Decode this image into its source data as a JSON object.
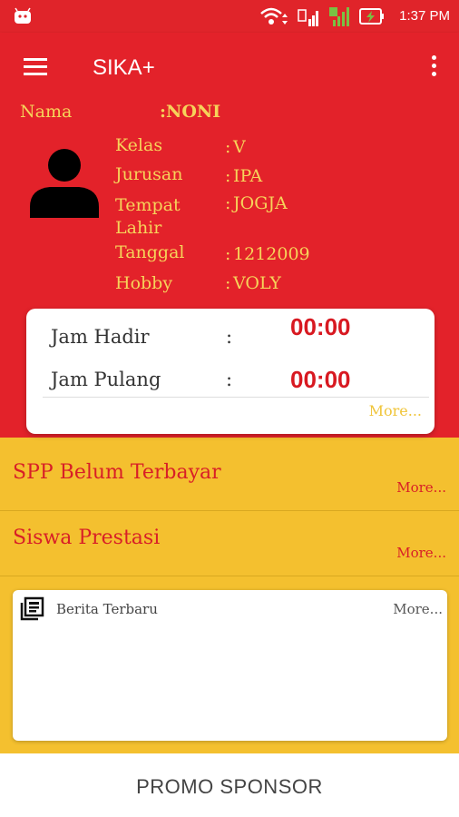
{
  "status_bar": {
    "time": "1:37 PM"
  },
  "app_bar": {
    "title": "SIKA+"
  },
  "profile": {
    "nama_label": "Nama",
    "nama_value": ":NONI",
    "kelas_label": "Kelas",
    "kelas_value": "V",
    "jurusan_label": "Jurusan",
    "jurusan_value": "IPA",
    "tempat_label_line1": "Tempat",
    "tempat_label_line2": "Lahir",
    "tempat_value": "JOGJA",
    "tanggal_label": "Tanggal",
    "tanggal_value": "1212009",
    "hobby_label": "Hobby",
    "hobby_value": "VOLY",
    "colon": ":"
  },
  "attendance": {
    "jam_hadir_label": "Jam Hadir",
    "jam_hadir_value": "00:00",
    "jam_pulang_label": "Jam Pulang",
    "jam_pulang_value": "00:00",
    "colon": ":",
    "more": "More..."
  },
  "sections": {
    "spp_title": "SPP Belum Terbayar",
    "spp_more": "More...",
    "prestasi_title": "Siswa Prestasi",
    "prestasi_more": "More..."
  },
  "news": {
    "title": "Berita Terbaru",
    "more": "More..."
  },
  "footer": {
    "promo": "PROMO SPONSOR"
  },
  "colors": {
    "red": "#e3222a",
    "yellow": "#f4c02f",
    "accent_text": "#f6d35a",
    "time_red": "#d81921"
  },
  "icons": [
    "android-icon",
    "wifi-icon",
    "signal-icon",
    "battery-icon",
    "menu-icon",
    "overflow-menu-icon",
    "avatar-icon",
    "news-icon"
  ]
}
